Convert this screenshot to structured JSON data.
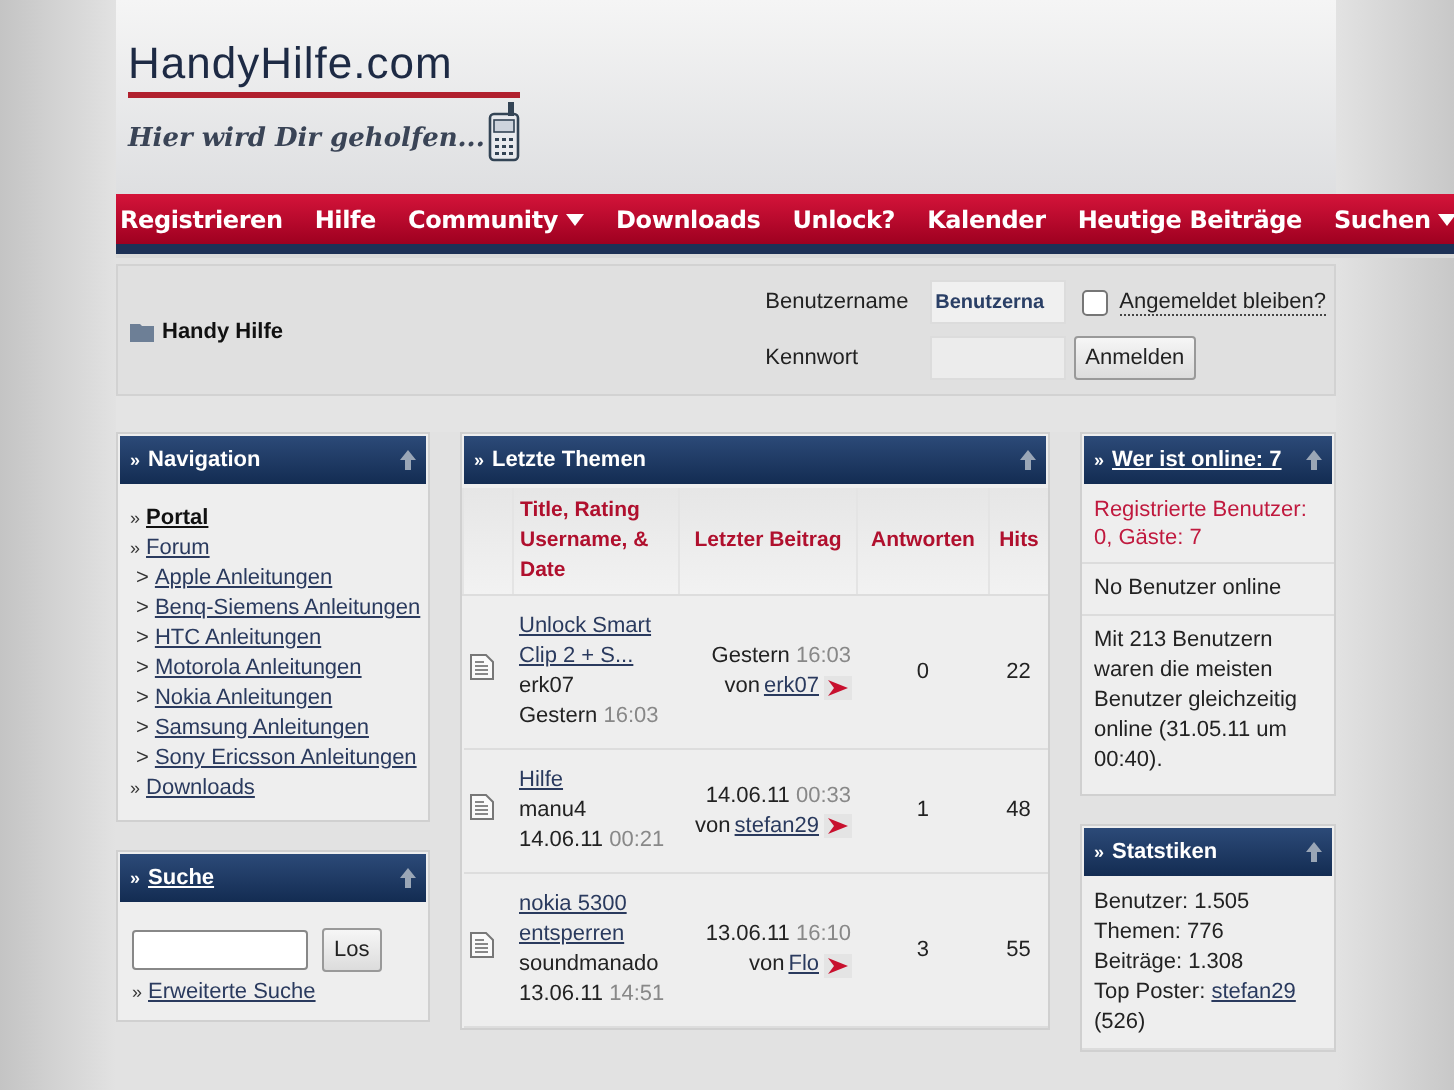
{
  "logo": {
    "title": "HandyHilfe.com",
    "slogan": "Hier wird Dir geholfen..."
  },
  "nav": [
    {
      "label": "Registrieren",
      "dropdown": false
    },
    {
      "label": "Hilfe",
      "dropdown": false
    },
    {
      "label": "Community",
      "dropdown": true
    },
    {
      "label": "Downloads",
      "dropdown": false
    },
    {
      "label": "Unlock?",
      "dropdown": false
    },
    {
      "label": "Kalender",
      "dropdown": false
    },
    {
      "label": "Heutige Beiträge",
      "dropdown": false
    },
    {
      "label": "Suchen",
      "dropdown": true
    }
  ],
  "breadcrumb": "Handy Hilfe",
  "login": {
    "username_label": "Benutzername",
    "username_value": "Benutzerna",
    "password_label": "Kennwort",
    "remember_label": "Angemeldet bleiben?",
    "remember_checked": false,
    "button": "Anmelden"
  },
  "navigation": {
    "marker": "»",
    "title": "Navigation",
    "items": [
      {
        "marker": "»",
        "label": "Portal",
        "selected": true
      },
      {
        "marker": "»",
        "label": "Forum",
        "selected": false
      },
      {
        "marker": ">",
        "label": "Apple Anleitungen",
        "selected": false
      },
      {
        "marker": ">",
        "label": "Benq-Siemens Anleitungen",
        "selected": false
      },
      {
        "marker": ">",
        "label": "HTC Anleitungen",
        "selected": false
      },
      {
        "marker": ">",
        "label": "Motorola Anleitungen",
        "selected": false
      },
      {
        "marker": ">",
        "label": "Nokia Anleitungen",
        "selected": false
      },
      {
        "marker": ">",
        "label": "Samsung Anleitungen",
        "selected": false
      },
      {
        "marker": ">",
        "label": "Sony Ericsson Anleitungen",
        "selected": false
      },
      {
        "marker": "»",
        "label": "Downloads",
        "selected": false
      }
    ]
  },
  "search": {
    "marker": "»",
    "title": "Suche",
    "button": "Los",
    "advanced_marker": "»",
    "advanced": "Erweiterte Suche"
  },
  "threads": {
    "marker": "»",
    "title": "Letzte Themen",
    "columns": [
      "Title, Rating Username, & Date",
      "Letzter Beitrag",
      "Antworten",
      "Hits"
    ],
    "rows": [
      {
        "title": "Unlock Smart Clip 2 + S...",
        "user": "erk07",
        "date": "Gestern",
        "time": "16:03",
        "last_date": "Gestern",
        "last_time": "16:03",
        "last_by": "von",
        "last_user": "erk07",
        "answers": "0",
        "hits": "22"
      },
      {
        "title": "Hilfe",
        "user": "manu4",
        "date": "14.06.11",
        "time": "00:21",
        "last_date": "14.06.11",
        "last_time": "00:33",
        "last_by": "von",
        "last_user": "stefan29",
        "answers": "1",
        "hits": "48"
      },
      {
        "title": "nokia 5300 entsperren",
        "user": "soundmanado",
        "date": "13.06.11",
        "time": "14:51",
        "last_date": "13.06.11",
        "last_time": "16:10",
        "last_by": "von",
        "last_user": "Flo",
        "answers": "3",
        "hits": "55"
      }
    ]
  },
  "online": {
    "marker": "»",
    "title": "Wer ist online: 7",
    "registered": "Registrierte Benutzer: 0, Gäste: 7",
    "users": "No Benutzer online",
    "record": "Mit 213 Benutzern waren die meisten Benutzer gleichzeitig online (31.05.11 um 00:40)."
  },
  "stats": {
    "marker": "»",
    "title": "Statstiken",
    "lines": [
      "Benutzer: 1.505",
      "Themen: 776",
      "Beiträge: 1.308"
    ],
    "top_label": "Top Poster:",
    "top_user": "stefan29",
    "top_count": "(526)"
  }
}
